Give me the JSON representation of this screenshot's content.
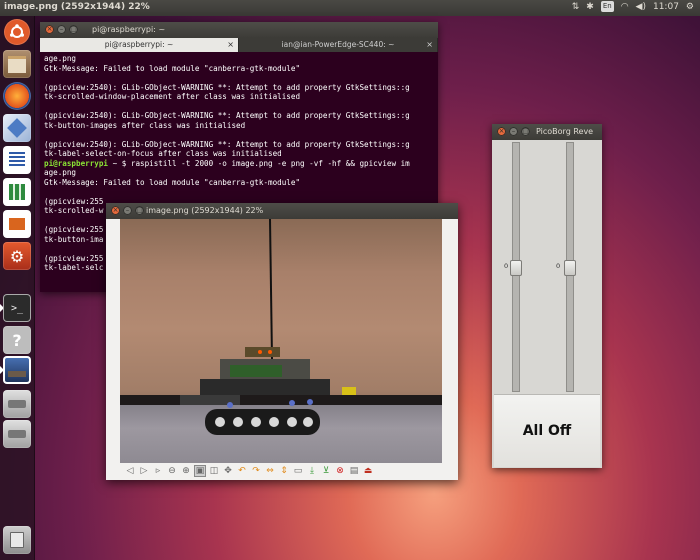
{
  "topbar": {
    "title": "image.png (2592x1944) 22%",
    "keyboard_layout": "En",
    "clock": "11:07"
  },
  "terminal": {
    "title": "pi@raspberrypi: ~",
    "tabs": [
      {
        "label": "pi@raspberrypi: ~"
      },
      {
        "label": "ian@ian-PowerEdge-SC440: ~"
      }
    ],
    "lines": [
      "age.png",
      "Gtk-Message: Failed to load module \"canberra-gtk-module\"",
      "",
      "(gpicview:2540): GLib-GObject-WARNING **: Attempt to add property GtkSettings::g",
      "tk-scrolled-window-placement after class was initialised",
      "",
      "(gpicview:2540): GLib-GObject-WARNING **: Attempt to add property GtkSettings::g",
      "tk-button-images after class was initialised",
      "",
      "(gpicview:2540): GLib-GObject-WARNING **: Attempt to add property GtkSettings::g",
      "tk-label-select-on-focus after class was initialised",
      "",
      "Gtk-Message: Failed to load module \"canberra-gtk-module\"",
      "",
      "(gpicview:255",
      "tk-scrolled-w",
      "",
      "(gpicview:255",
      "tk-button-ima",
      "",
      "(gpicview:255",
      "tk-label-selc"
    ],
    "prompt": "pi@raspberrypi",
    "command": " ~ $ raspistill -t 2000 -o image.png -e png -vf -hf && gpicview im",
    "command_continued": "age.png"
  },
  "viewer": {
    "title": "image.png (2592x1944) 22%",
    "toolbar_icons": [
      "prev-icon",
      "next-icon",
      "play-icon",
      "zoom-out-icon",
      "zoom-in-icon",
      "fit-icon",
      "original-size-icon",
      "fullscreen-icon",
      "rotate-left-icon",
      "rotate-right-icon",
      "flip-horizontal-icon",
      "flip-vertical-icon",
      "open-icon",
      "save-icon",
      "delete-icon",
      "preferences-icon",
      "quit-icon"
    ]
  },
  "picoborg": {
    "title": "PicoBorg Reve",
    "left_slider_label": "0",
    "right_slider_label": "0",
    "all_off_label": "All Off",
    "left_value_fraction": 0.5,
    "right_value_fraction": 0.5
  }
}
